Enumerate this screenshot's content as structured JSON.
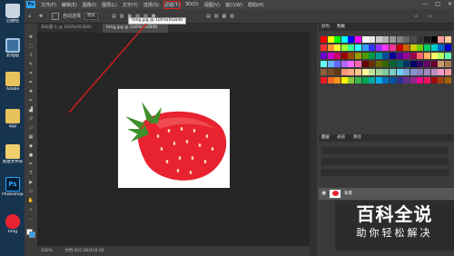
{
  "colors": {
    "desktop_bg": "#17344f",
    "ps_blue": "#2fa3f7",
    "highlight_red": "#e02020",
    "strawberry": "#e8232f"
  },
  "desktop": {
    "icons": [
      {
        "label": "回收站",
        "icon": "recycle-bin-icon"
      },
      {
        "label": "此电脑",
        "icon": "computer-icon"
      },
      {
        "label": "Adobe",
        "icon": "folder-icon"
      },
      {
        "label": "app",
        "icon": "folder-icon"
      },
      {
        "label": "新建文件夹",
        "icon": "folder-icon"
      },
      {
        "label": "Photoshop 快捷方式",
        "icon": "photoshop-icon"
      },
      {
        "label": "timg",
        "icon": "image-file-icon"
      }
    ]
  },
  "menubar": {
    "logo": "Ps",
    "items": [
      "文件(F)",
      "编辑(E)",
      "图像(I)",
      "图层(L)",
      "文字(Y)",
      "选择(S)",
      "滤镜(T)",
      "3D(D)",
      "视图(V)",
      "窗口(W)",
      "帮助(H)"
    ],
    "highlighted_item": "滤镜(T)",
    "window_controls": [
      "—",
      "□",
      "✕"
    ]
  },
  "options": {
    "auto_select": "自动选择",
    "group_select": "图层"
  },
  "document": {
    "tabs": [
      "未标题-1 @ 100%(RGB/8)",
      "timg.jpg @ 100%(RGB/8)"
    ],
    "active_tab": 1,
    "tooltip": "timg.jpg @ 100%(RGB/8)"
  },
  "status": {
    "zoom": "100%",
    "doc_size": "文档:410.2K/410.2K"
  },
  "panels": {
    "swatch_tabs": [
      "颜色",
      "色板"
    ],
    "active_swatch_tab": 1,
    "layer_tabs": [
      "图层",
      "通道",
      "路径"
    ],
    "layer_name": "背景"
  },
  "watermark": {
    "title": "百科全说",
    "subtitle": "助你轻松解决"
  }
}
